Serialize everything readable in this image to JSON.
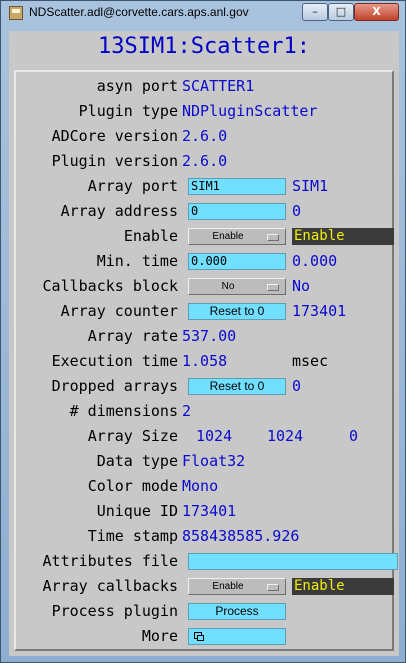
{
  "window": {
    "title": "NDScatter.adl@corvette.cars.aps.anl.gov",
    "minimize": "–",
    "maximize": "□",
    "close": "X"
  },
  "screen_title": "13SIM1:Scatter1:",
  "rows": {
    "asyn_port": {
      "label": "asyn port",
      "value": "SCATTER1"
    },
    "plugin_type": {
      "label": "Plugin type",
      "value": "NDPluginScatter"
    },
    "adcore_version": {
      "label": "ADCore version",
      "value": "2.6.0"
    },
    "plugin_version": {
      "label": "Plugin version",
      "value": "2.6.0"
    },
    "array_port": {
      "label": "Array port",
      "input": "SIM1",
      "readback": "SIM1"
    },
    "array_address": {
      "label": "Array address",
      "input": "0",
      "readback": "0"
    },
    "enable": {
      "label": "Enable",
      "menu": "Enable",
      "status": "Enable"
    },
    "min_time": {
      "label": "Min. time",
      "input": "0.000",
      "readback": "0.000"
    },
    "callbacks_block": {
      "label": "Callbacks block",
      "menu": "No",
      "readback": "No"
    },
    "array_counter": {
      "label": "Array counter",
      "button": "Reset to 0",
      "readback": "173401"
    },
    "array_rate": {
      "label": "Array rate",
      "value": "537.00"
    },
    "execution_time": {
      "label": "Execution time",
      "value": "1.058",
      "unit": "msec"
    },
    "dropped_arrays": {
      "label": "Dropped arrays",
      "button": "Reset to 0",
      "readback": "0"
    },
    "dimensions": {
      "label": "# dimensions",
      "value": "2"
    },
    "array_size": {
      "label": "Array Size",
      "values": [
        "1024",
        "1024",
        "0"
      ]
    },
    "data_type": {
      "label": "Data type",
      "value": "Float32"
    },
    "color_mode": {
      "label": "Color mode",
      "value": "Mono"
    },
    "unique_id": {
      "label": "Unique ID",
      "value": "173401"
    },
    "time_stamp": {
      "label": "Time stamp",
      "value": "858438585.926"
    },
    "attributes_file": {
      "label": "Attributes file",
      "input": ""
    },
    "array_callbacks": {
      "label": "Array callbacks",
      "menu": "Enable",
      "status": "Enable"
    },
    "process_plugin": {
      "label": "Process plugin",
      "button": "Process"
    },
    "more": {
      "label": "More"
    }
  },
  "colors": {
    "input_bg": "#73dfff",
    "readback_text": "#0a0ad0",
    "status_bg": "#3a3a3a",
    "status_text": "#f0f000",
    "panel_bg": "#c8c8c8"
  },
  "icons": {
    "app": "app-icon",
    "more": "related-display-icon"
  }
}
